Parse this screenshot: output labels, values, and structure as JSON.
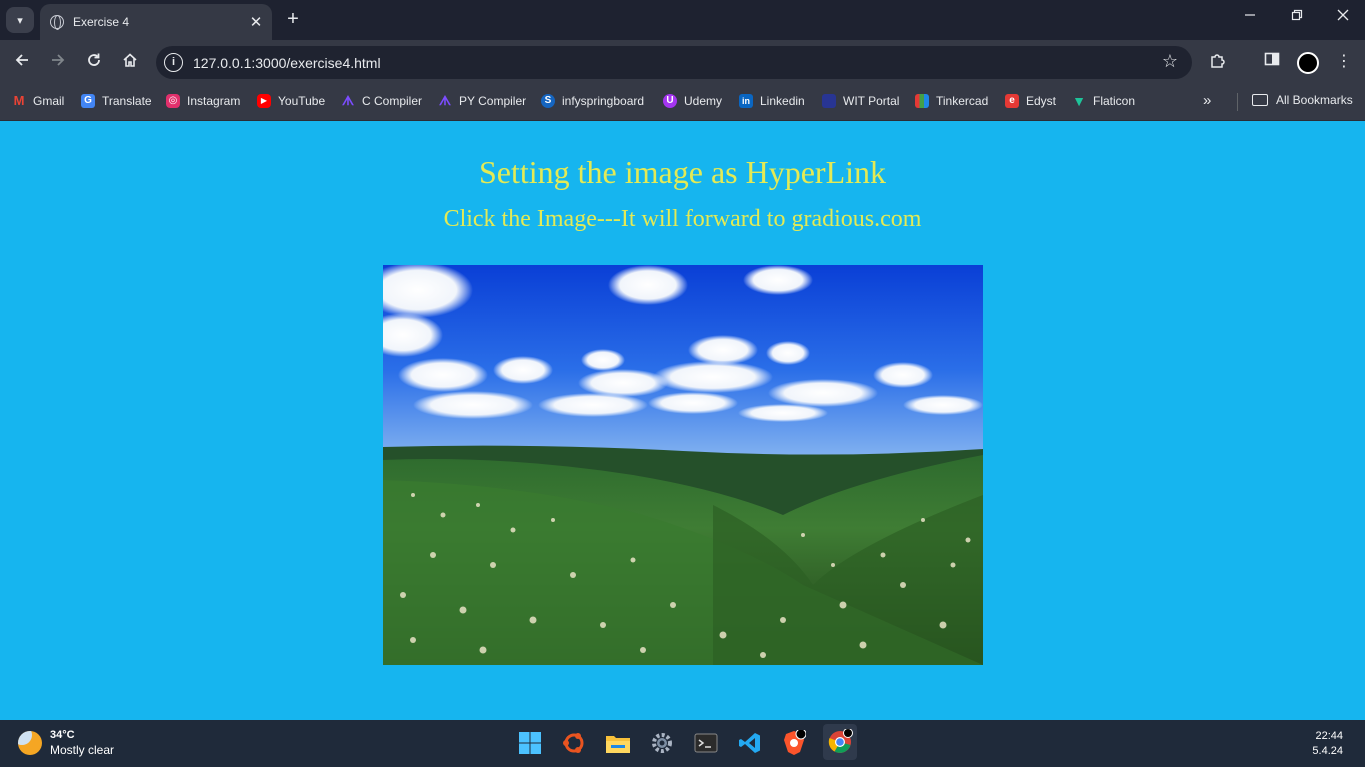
{
  "browser": {
    "tab_title": "Exercise 4",
    "url": "127.0.0.1:3000/exercise4.html",
    "new_tab": "+",
    "tab_close": "✕"
  },
  "bookmarks": [
    {
      "label": "Gmail",
      "icon": "gmail-icon",
      "color": "#ea4335"
    },
    {
      "label": "Translate",
      "icon": "translate-icon",
      "color": "#4285f4"
    },
    {
      "label": "Instagram",
      "icon": "instagram-icon",
      "color": "#e1306c"
    },
    {
      "label": "YouTube",
      "icon": "youtube-icon",
      "color": "#ff0000"
    },
    {
      "label": "C Compiler",
      "icon": "c-compiler-icon",
      "color": "#7c4dff"
    },
    {
      "label": "PY Compiler",
      "icon": "py-compiler-icon",
      "color": "#7c4dff"
    },
    {
      "label": "infyspringboard",
      "icon": "infyspringboard-icon",
      "color": "#1565c0"
    },
    {
      "label": "Udemy",
      "icon": "udemy-icon",
      "color": "#a435f0"
    },
    {
      "label": "Linkedin",
      "icon": "linkedin-icon",
      "color": "#0a66c2"
    },
    {
      "label": "WIT Portal",
      "icon": "wit-portal-icon",
      "color": "#3949ab"
    },
    {
      "label": "Tinkercad",
      "icon": "tinkercad-icon",
      "color": "#f4511e"
    },
    {
      "label": "Edyst",
      "icon": "edyst-icon",
      "color": "#e53935"
    },
    {
      "label": "Flaticon",
      "icon": "flaticon-icon",
      "color": "#1ec49a"
    }
  ],
  "bookmarks_more": "»",
  "all_bookmarks": "All Bookmarks",
  "page": {
    "heading": "Setting the image as HyperLink",
    "subheading": "Click the Image---It will forward to gradious.com",
    "background": "#16b5ef",
    "text_color": "#e3ea55"
  },
  "taskbar": {
    "temperature": "34°C",
    "weather": "Mostly clear",
    "time": "22:44",
    "date": "5.4.24"
  }
}
